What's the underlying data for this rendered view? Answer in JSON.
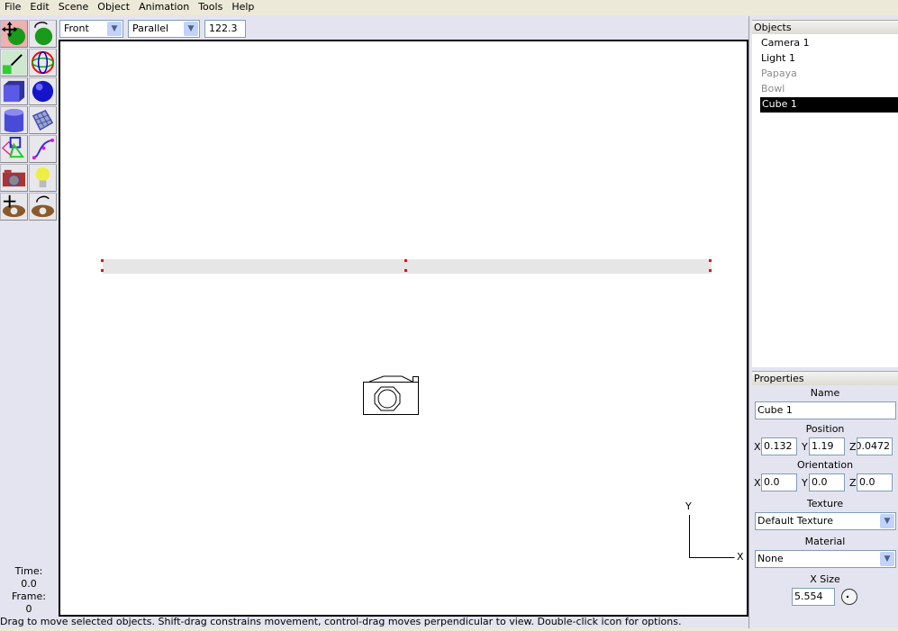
{
  "menu": [
    "File",
    "Edit",
    "Scene",
    "Object",
    "Animation",
    "Tools",
    "Help"
  ],
  "toolbar": {
    "view": "Front",
    "projection": "Parallel",
    "scale": "122.3"
  },
  "tools": [
    "move-icon",
    "rotate-icon",
    "scale-icon",
    "transform-icon",
    "cube-icon",
    "sphere-icon",
    "cylinder-icon",
    "polymesh-icon",
    "polygon-icon",
    "curve-icon",
    "camera-icon",
    "light-icon",
    "move-view-icon",
    "rotate-view-icon"
  ],
  "time": {
    "time_label": "Time:",
    "time_value": "0.0",
    "frame_label": "Frame:",
    "frame_value": "0"
  },
  "status": "Drag to move selected objects.  Shift-drag constrains movement, control-drag moves perpendicular to view.  Double-click icon for options.",
  "viewport": {
    "axis_y": "Y",
    "axis_x": "X"
  },
  "objects": {
    "title": "Objects",
    "items": [
      {
        "name": "Camera 1",
        "state": "normal"
      },
      {
        "name": "Light 1",
        "state": "normal"
      },
      {
        "name": "Papaya",
        "state": "hidden"
      },
      {
        "name": "Bowl",
        "state": "hidden"
      },
      {
        "name": "Cube 1",
        "state": "selected"
      }
    ]
  },
  "properties": {
    "title": "Properties",
    "name_label": "Name",
    "name": "Cube 1",
    "position_label": "Position",
    "pos": {
      "x": "0.132",
      "y": "1.19",
      "z": "0.0472"
    },
    "orientation_label": "Orientation",
    "orient": {
      "x": "0.0",
      "y": "0.0",
      "z": "0.0"
    },
    "axis_x": "X",
    "axis_y": "Y",
    "axis_z": "Z",
    "texture_label": "Texture",
    "texture": "Default Texture",
    "material_label": "Material",
    "material": "None",
    "xsize_label": "X Size",
    "xsize": "5.554"
  }
}
